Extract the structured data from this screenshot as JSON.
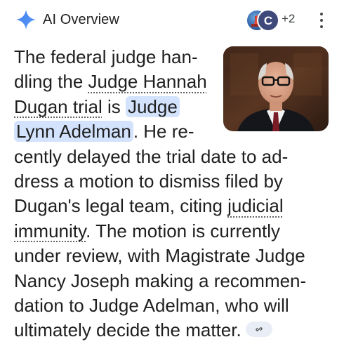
{
  "header": {
    "title": "AI Overview",
    "sources_more": "+2",
    "source_b_initial": "C"
  },
  "icons": {
    "sparkle": "sparkle-icon",
    "menu": "more-vert-icon",
    "link": "link-icon"
  },
  "colors": {
    "sparkle_blue": "#4f86ec",
    "highlight": "#d3e3fd",
    "chip": "#e9eef6",
    "text": "#1f1f1f"
  },
  "answer": {
    "l1": "The federal judge han-",
    "l2a": "dling the ",
    "l2b": "Judge Hannah",
    "l3a": "Dugan trial",
    "l3b": " is ",
    "l3c": "Judge",
    "l4a": "Lynn Adelman",
    "l4b": ". He re-",
    "l5": "cently delayed the trial date to ad-",
    "l6": "dress a motion to dismiss filed by",
    "l7a": "Dugan's legal team, citing ",
    "l7b": "judicial",
    "l8a": "immunity",
    "l8b": ". The motion is currently",
    "l9": "under review, with Magistrate Judge",
    "l10": "Nancy Joseph making a recommen-",
    "l11": "dation to Judge Adelman, who will",
    "l12": "ultimately decide the matter."
  }
}
